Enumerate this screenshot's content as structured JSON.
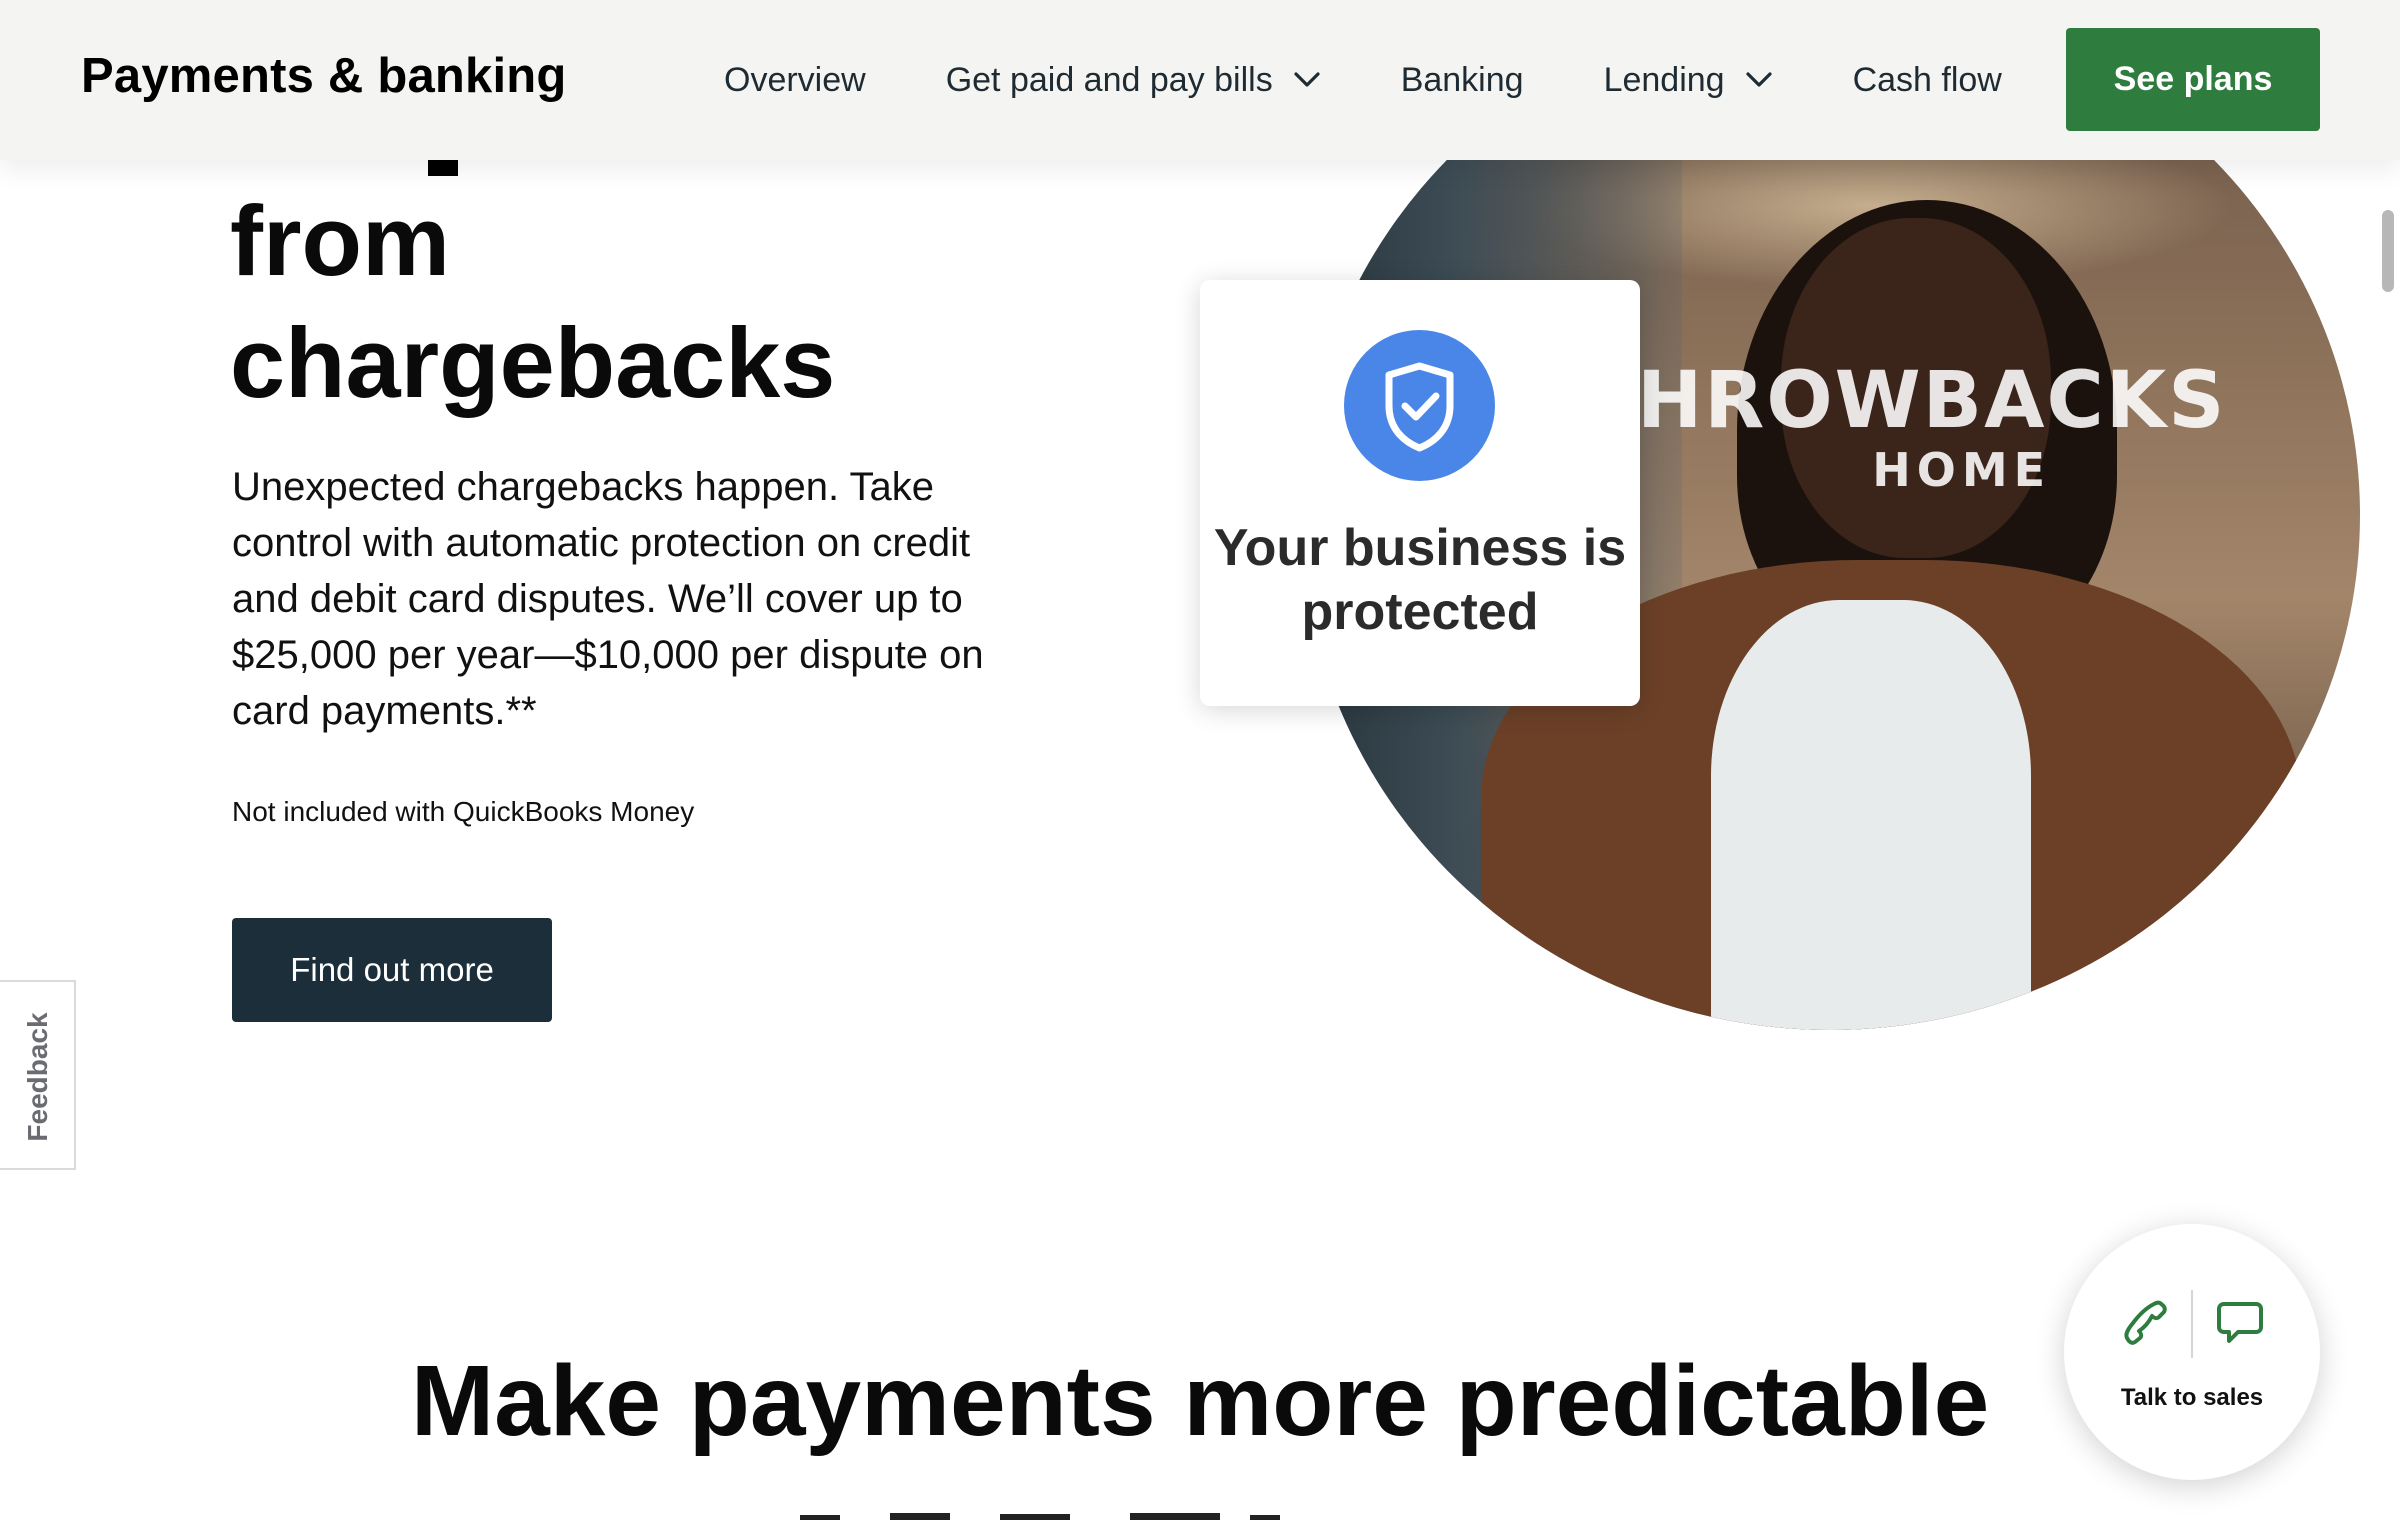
{
  "header": {
    "brand": "Payments & banking",
    "nav": [
      {
        "label": "Overview"
      },
      {
        "label": "Get paid and pay bills",
        "icon": "chevron-down-icon"
      },
      {
        "label": "Banking"
      },
      {
        "label": "Lending",
        "icon": "chevron-down-icon"
      },
      {
        "label": "Cash flow"
      }
    ],
    "cta": "See plans"
  },
  "hero": {
    "title_lines": [
      "from",
      "chargebacks"
    ],
    "body": "Unexpected chargebacks happen. Take control with automatic protection on credit and debit card disputes. We’ll cover up to $25,000 per year—$10,000 per dispute on card payments.**",
    "note": "Not included with QuickBooks Money",
    "cta": "Find out more",
    "image": {
      "store_sign_line1": "HROWBACKS",
      "store_sign_line2": "HOME",
      "card_icon": "shield-check-icon",
      "card_text": "Your business is protected"
    }
  },
  "feedback": {
    "label": "Feedback"
  },
  "section": {
    "title": "Make payments more predictable"
  },
  "sales_widget": {
    "label": "Talk to sales",
    "phone_icon": "phone-icon",
    "chat_icon": "chat-icon"
  },
  "colors": {
    "nav_background": "#f4f4f2",
    "primary_cta": "#2e7d3f",
    "secondary_cta": "#1c2e3a",
    "shield_blue": "#4a86e8",
    "sales_icon_green": "#2e7d3f"
  }
}
